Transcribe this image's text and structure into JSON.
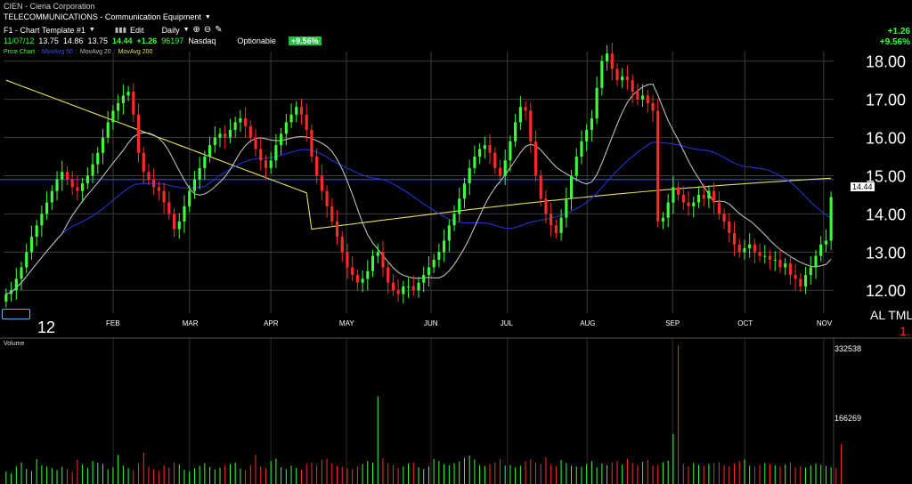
{
  "header": {
    "title": "CIEN - Ciena Corporation",
    "industry": "TELECOMMUNICATIONS - Communication Equipment",
    "template": "F1 - Chart Template #1",
    "edit": "Edit",
    "period": "Daily",
    "quote": {
      "date": "11/07/12",
      "open": "13.75",
      "high": "14.86",
      "low": "13.75",
      "last": "14.44",
      "change": "+1.26",
      "volume": "96197",
      "exchange": "Nasdaq",
      "optionable": "Optionable",
      "pct": "+9.56%"
    },
    "right_change": "+1.26",
    "right_pct": "+9.56%"
  },
  "legend": {
    "price_chart": "Price Chart",
    "ma50": "MovAvg 50",
    "ma20": "MovAvg 20",
    "ma200": "MovAvg 200"
  },
  "colors": {
    "up": "#3cff3c",
    "down": "#ff2a2a",
    "ma50": "#2233cc",
    "ma20": "#bdbdbd",
    "ma200": "#e6e05a",
    "hline": "#2a3fd8",
    "grid": "#3b3b3b"
  },
  "year_label": "12",
  "price_tag": "14.44",
  "al_tml": "AL TML",
  "al_tml_sub": "1.",
  "volume_label": "Volume",
  "chart_data": [
    {
      "type": "candlestick",
      "title": "CIEN - Ciena Corporation",
      "x_ticks": [
        "FEB",
        "MAR",
        "APR",
        "MAY",
        "JUN",
        "JUL",
        "AUG",
        "SEP",
        "OCT",
        "NOV"
      ],
      "y_ticks": [
        "18.00",
        "17.00",
        "16.00",
        "15.00",
        "14.00",
        "13.00",
        "12.00"
      ],
      "ylim": [
        11.4,
        18.25
      ],
      "grid": true,
      "horizontal_line": 14.9,
      "prices": [
        11.9,
        12.0,
        12.3,
        12.6,
        13.0,
        13.4,
        13.7,
        14.0,
        14.3,
        14.6,
        14.9,
        15.1,
        14.9,
        14.7,
        14.6,
        14.8,
        15.0,
        15.3,
        15.6,
        16.0,
        16.4,
        16.7,
        16.9,
        17.1,
        17.2,
        16.6,
        15.6,
        15.1,
        14.9,
        14.7,
        14.6,
        14.3,
        14.0,
        13.6,
        13.8,
        14.2,
        14.6,
        14.9,
        15.2,
        15.5,
        15.8,
        16.0,
        16.1,
        16.0,
        16.2,
        16.4,
        16.5,
        16.3,
        16.0,
        15.7,
        15.4,
        15.2,
        15.4,
        15.8,
        16.1,
        16.4,
        16.6,
        16.8,
        16.6,
        16.2,
        15.5,
        15.0,
        14.6,
        14.2,
        13.8,
        13.4,
        13.0,
        12.6,
        12.4,
        12.2,
        12.3,
        12.5,
        12.9,
        13.0,
        12.6,
        12.2,
        12.0,
        11.9,
        12.1,
        12.1,
        12.0,
        12.2,
        12.4,
        12.6,
        12.8,
        13.0,
        13.3,
        13.7,
        14.0,
        14.4,
        14.8,
        15.2,
        15.5,
        15.7,
        15.8,
        15.6,
        15.2,
        15.0,
        15.4,
        15.9,
        16.4,
        16.8,
        16.7,
        15.9,
        15.0,
        14.4,
        14.0,
        13.7,
        13.5,
        13.9,
        14.4,
        15.0,
        15.5,
        15.9,
        16.2,
        16.5,
        17.3,
        18.0,
        18.2,
        17.8,
        17.5,
        17.6,
        17.5,
        17.2,
        17.0,
        17.1,
        16.9,
        16.7,
        13.8,
        13.9,
        14.3,
        14.7,
        14.5,
        14.3,
        14.2,
        14.3,
        14.5,
        14.4,
        14.6,
        14.3,
        14.0,
        13.8,
        13.5,
        13.2,
        13.0,
        13.1,
        13.2,
        13.0,
        12.9,
        12.9,
        12.8,
        12.8,
        12.6,
        12.7,
        12.4,
        12.3,
        12.1,
        12.4,
        12.6,
        12.9,
        13.2,
        13.3,
        14.44
      ],
      "volume": {
        "ylim": [
          0,
          332538
        ],
        "y_ticks": [
          "332538",
          "166269"
        ],
        "values": [
          30000,
          26000,
          42000,
          52000,
          36000,
          31000,
          60000,
          45000,
          42000,
          38000,
          33000,
          41000,
          36000,
          29000,
          58000,
          47000,
          39000,
          55000,
          51000,
          48000,
          35000,
          40000,
          70000,
          44000,
          38000,
          33000,
          49000,
          75000,
          42000,
          36000,
          31000,
          45000,
          39000,
          52000,
          47000,
          34000,
          30000,
          38000,
          44000,
          50000,
          41000,
          35000,
          39000,
          45000,
          48000,
          52000,
          37000,
          33000,
          46000,
          70000,
          42000,
          38000,
          55000,
          61000,
          40000,
          36000,
          44000,
          39000,
          35000,
          48000,
          52000,
          45000,
          58000,
          60000,
          49000,
          44000,
          41000,
          38000,
          36000,
          42000,
          48000,
          55000,
          51000,
          210000,
          62000,
          50000,
          45000,
          38000,
          42000,
          49000,
          52000,
          40000,
          36000,
          42000,
          60000,
          55000,
          48000,
          45000,
          50000,
          54000,
          62000,
          68000,
          59000,
          45000,
          43000,
          48000,
          52000,
          60000,
          44000,
          46000,
          40000,
          44000,
          55000,
          59000,
          52000,
          48000,
          64000,
          47000,
          43000,
          58000,
          50000,
          44000,
          42000,
          41000,
          48000,
          55000,
          40000,
          49000,
          45000,
          52000,
          55000,
          47000,
          61000,
          50000,
          45000,
          53000,
          58000,
          44000,
          46000,
          52000,
          56000,
          120000,
          332538,
          48000,
          42000,
          50000,
          46000,
          44000,
          48000,
          50000,
          52000,
          45000,
          43000,
          49000,
          55000,
          59000,
          44000,
          42000,
          46000,
          50000,
          48000,
          45000,
          43000,
          47000,
          52000,
          40000,
          42000,
          39000,
          45000,
          49000,
          46000,
          43000,
          40000,
          38000,
          96197
        ]
      }
    }
  ]
}
